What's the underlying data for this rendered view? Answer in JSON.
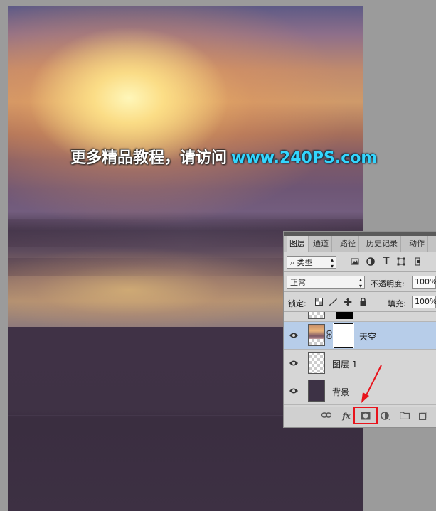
{
  "watermark": {
    "cn_text": "更多精品教程，请访问",
    "url_text": "www.240PS.com"
  },
  "layers_panel": {
    "tabs": [
      "图层",
      "通道",
      "路径",
      "历史记录",
      "动作"
    ],
    "filter": {
      "label": "类型",
      "icon": "search-icon"
    },
    "filter_icons": [
      "image-filter-icon",
      "adjustment-filter-icon",
      "type-filter-icon",
      "shape-filter-icon",
      "smart-object-filter-icon"
    ],
    "filter_type_glyph": "T",
    "blend_mode": "正常",
    "opacity_label": "不透明度:",
    "opacity_value": "100%",
    "lock_label": "锁定:",
    "fill_label": "填充:",
    "fill_value": "100%",
    "layers": [
      {
        "name": "天空",
        "visible": true,
        "selected": true,
        "has_mask": true
      },
      {
        "name": "图层 1",
        "visible": true,
        "selected": false,
        "has_mask": false
      },
      {
        "name": "背景",
        "visible": true,
        "selected": false,
        "has_mask": false
      }
    ],
    "bottom_icons": [
      "link-layers-icon",
      "fx-icon",
      "add-mask-icon",
      "adjustment-layer-icon",
      "new-group-icon",
      "new-layer-icon"
    ],
    "fx_text": "fx"
  },
  "colors": {
    "selected_layer": "#b7cde9",
    "highlight": "#e8141c",
    "watermark_url": "#33d6ff",
    "ground": "#403246"
  }
}
